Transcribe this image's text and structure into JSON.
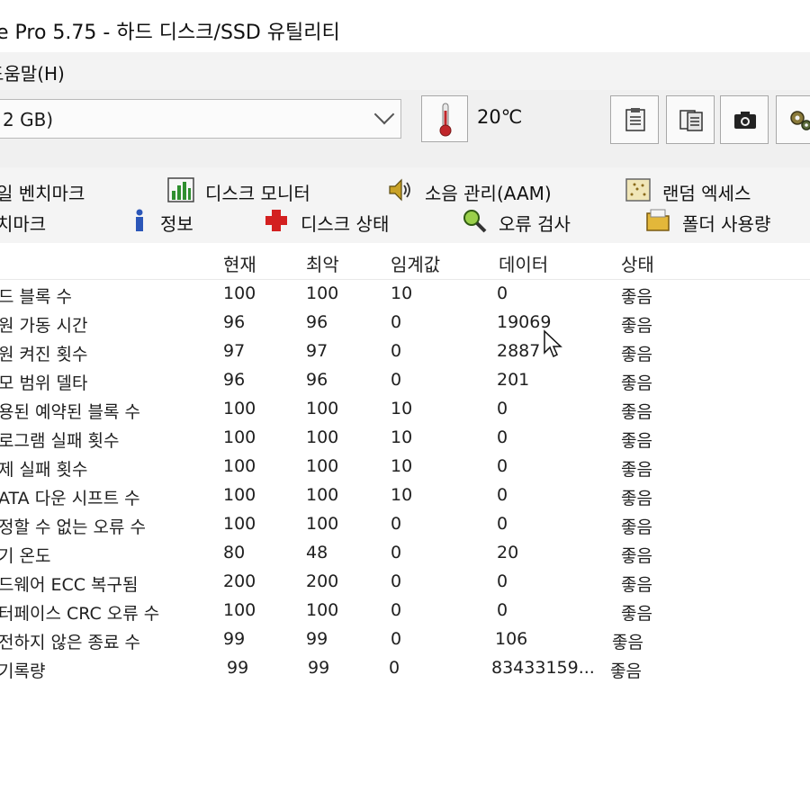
{
  "window": {
    "title": "e Pro 5.75 - 하드 디스크/SSD 유틸리티"
  },
  "menu": {
    "items": [
      {
        "label": "도움말(H)"
      }
    ]
  },
  "toolbar": {
    "drive_value": "2 GB)",
    "temperature": "20℃",
    "thermometer_icon": "thermometer-icon",
    "buttons": [
      {
        "name": "copy-text-button",
        "icon": "clipboard-text-icon"
      },
      {
        "name": "copy-all-button",
        "icon": "clipboard-copy-icon"
      },
      {
        "name": "screenshot-button",
        "icon": "camera-icon"
      },
      {
        "name": "options-button",
        "icon": "gears-icon"
      }
    ]
  },
  "tabs": {
    "row1": [
      {
        "label": "일 벤치마크",
        "icon": ""
      },
      {
        "label": "디스크 모니터",
        "icon": "bar-chart-icon"
      },
      {
        "label": "소음 관리(AAM)",
        "icon": "speaker-icon"
      },
      {
        "label": "랜덤 엑세스",
        "icon": "scatter-grid-icon"
      }
    ],
    "row2": [
      {
        "label": "치마크",
        "icon": ""
      },
      {
        "label": "정보",
        "icon": "info-icon"
      },
      {
        "label": "디스크 상태",
        "icon": "health-cross-icon"
      },
      {
        "label": "오류 검사",
        "icon": "magnifier-icon"
      },
      {
        "label": "폴더 사용량",
        "icon": "folder-icon"
      }
    ]
  },
  "smart_table": {
    "columns": [
      "",
      "현재",
      "최악",
      "임계값",
      "데이터",
      "상태"
    ],
    "rows": [
      {
        "attribute": "드 블록 수",
        "current": "100",
        "worst": "100",
        "threshold": "10",
        "data": "0",
        "status": "좋음"
      },
      {
        "attribute": "원 가동 시간",
        "current": "96",
        "worst": "96",
        "threshold": "0",
        "data": "19069",
        "status": "좋음"
      },
      {
        "attribute": "원 켜진 횟수",
        "current": "97",
        "worst": "97",
        "threshold": "0",
        "data": "2887",
        "status": "좋음"
      },
      {
        "attribute": "모 범위 델타",
        "current": "96",
        "worst": "96",
        "threshold": "0",
        "data": "201",
        "status": "좋음"
      },
      {
        "attribute": "용된 예약된 블록 수",
        "current": "100",
        "worst": "100",
        "threshold": "10",
        "data": "0",
        "status": "좋음"
      },
      {
        "attribute": "로그램 실패 횟수",
        "current": "100",
        "worst": "100",
        "threshold": "10",
        "data": "0",
        "status": "좋음"
      },
      {
        "attribute": "제 실패 횟수",
        "current": "100",
        "worst": "100",
        "threshold": "10",
        "data": "0",
        "status": "좋음"
      },
      {
        "attribute": "ATA 다운 시프트 수",
        "current": "100",
        "worst": "100",
        "threshold": "10",
        "data": "0",
        "status": "좋음"
      },
      {
        "attribute": "정할 수 없는 오류 수",
        "current": "100",
        "worst": "100",
        "threshold": "0",
        "data": "0",
        "status": "좋음"
      },
      {
        "attribute": "기 온도",
        "current": "80",
        "worst": "48",
        "threshold": "0",
        "data": "20",
        "status": "좋음"
      },
      {
        "attribute": "드웨어 ECC 복구됨",
        "current": "200",
        "worst": "200",
        "threshold": "0",
        "data": "0",
        "status": "좋음"
      },
      {
        "attribute": "터페이스 CRC 오류 수",
        "current": "100",
        "worst": "100",
        "threshold": "0",
        "data": "0",
        "status": "좋음"
      },
      {
        "attribute": "전하지 않은 종료 수",
        "current": "99",
        "worst": "99",
        "threshold": "0",
        "data": "106",
        "status": "좋음"
      },
      {
        "attribute": "기록량",
        "current": "99",
        "worst": "99",
        "threshold": "0",
        "data": "83433159...",
        "status": "좋음"
      }
    ]
  },
  "colors": {
    "thermometer_red": "#c0262b",
    "health_cross_red": "#d32020",
    "info_blue": "#2b56b8",
    "chart_green": "#2f8f2f"
  }
}
